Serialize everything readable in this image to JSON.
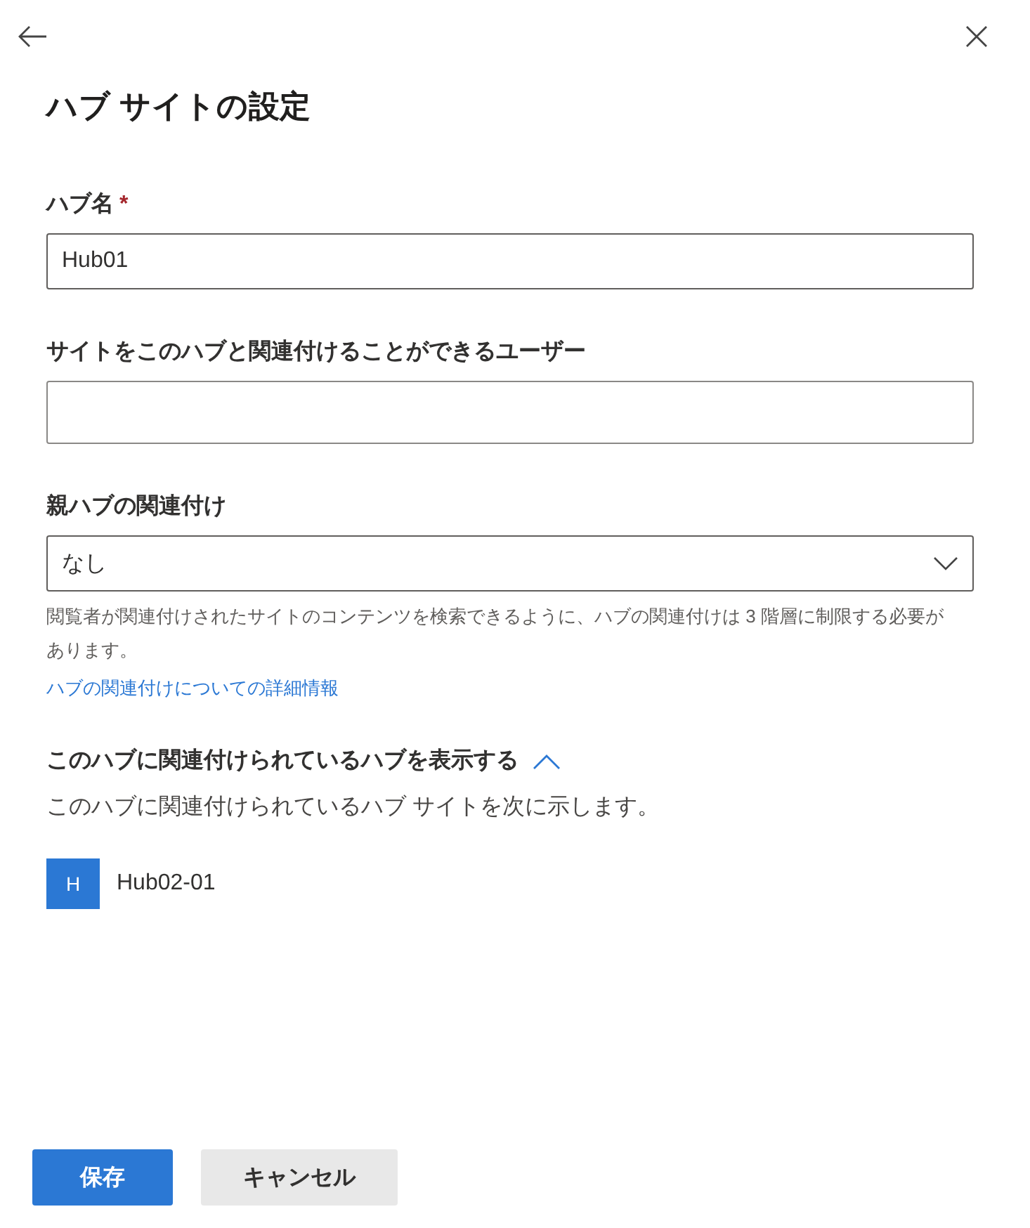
{
  "panel": {
    "title": "ハブ サイトの設定"
  },
  "fields": [
    {
      "kind": "text",
      "label": "ハブ名",
      "required_mark": "*",
      "value": "Hub01"
    },
    {
      "kind": "text",
      "label": "サイトをこのハブと関連付けることができるユーザー"
    },
    {
      "kind": "dropdown",
      "label": "親ハブの関連付け",
      "value": "なし",
      "help": "閲覧者が関連付けされたサイトのコンテンツを検索できるように、ハブの関連付けは 3 階層に制限する必要があります。",
      "link": "ハブの関連付けについての詳細情報"
    }
  ],
  "associated": {
    "heading": "このハブに関連付けられているハブを表示する",
    "expanded": true,
    "description": "このハブに関連付けられているハブ サイトを次に示します。",
    "items": [
      {
        "initial": "H",
        "name": "Hub02-01",
        "color": "#2b78d4"
      }
    ]
  },
  "buttons": [
    {
      "kind": "primary",
      "label": "保存"
    },
    {
      "kind": "secondary",
      "label": "キャンセル"
    }
  ]
}
